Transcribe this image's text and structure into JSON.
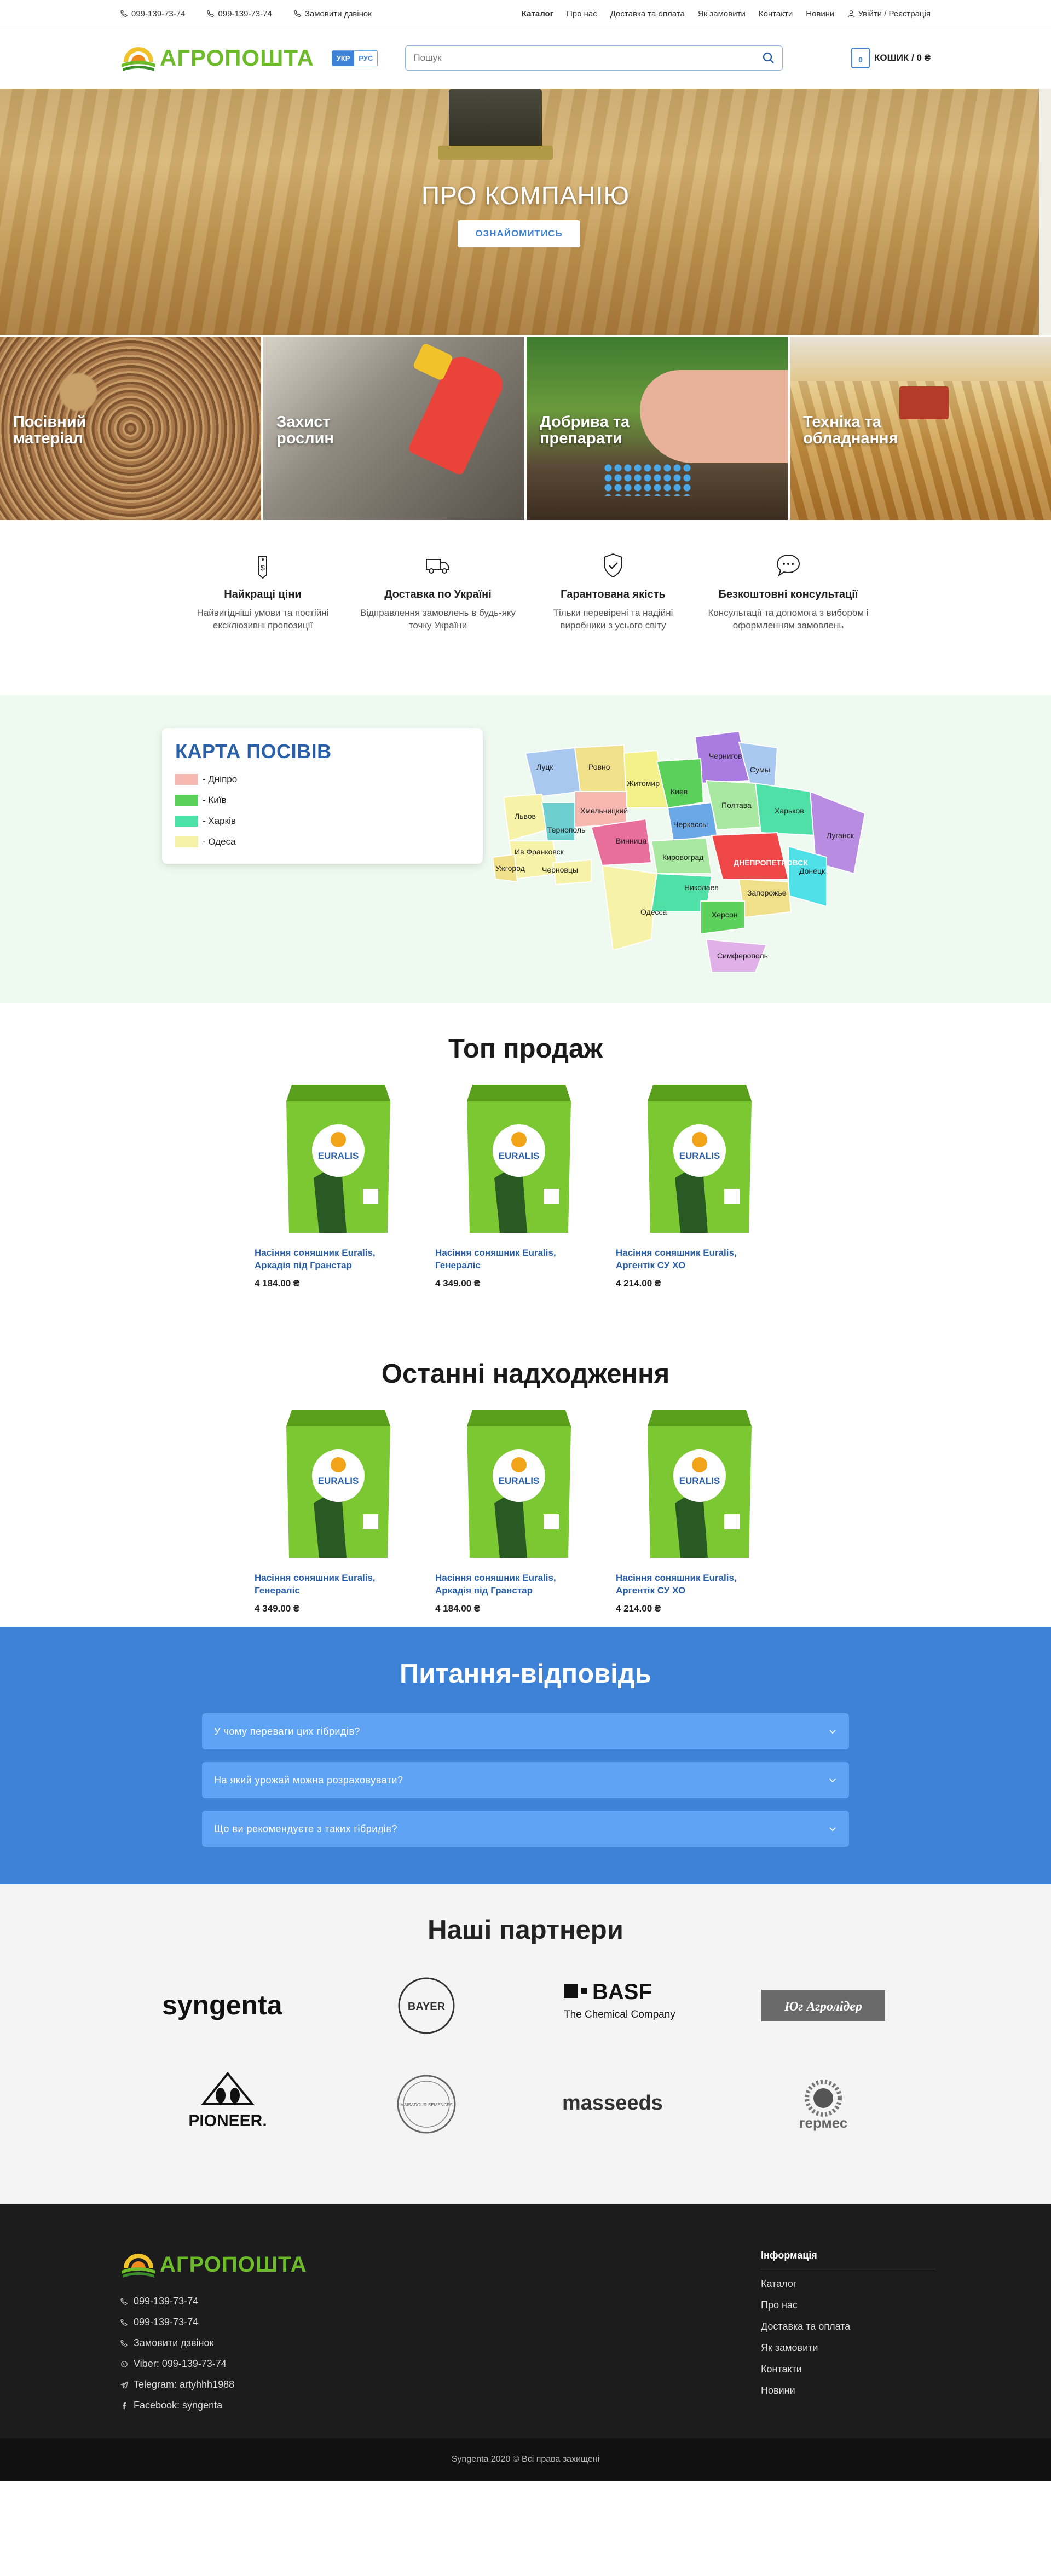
{
  "topbar": {
    "phone1": "099-139-73-74",
    "phone2": "099-139-73-74",
    "callback": "Замовити дзвінок",
    "nav": [
      "Каталог",
      "Про нас",
      "Доставка та оплата",
      "Як замовити",
      "Контакти",
      "Новини"
    ],
    "auth": "Увійти / Реєстрація"
  },
  "header": {
    "logo": "АГРОПОШТА",
    "lang_active": "УКР",
    "lang_other": "РУС",
    "search_placeholder": "Пошук",
    "cart_count": "0",
    "cart_label": "КОШИК / 0 ₴"
  },
  "hero": {
    "title": "ПРО КОМПАНІЮ",
    "button": "ОЗНАЙОМИТИСЬ"
  },
  "categories": [
    "Посівний матеріал",
    "Захист рослин",
    "Добрива та препарати",
    "Техніка та обладнання"
  ],
  "features": [
    {
      "icon": "price-tag-icon",
      "title": "Найкращі ціни",
      "text": "Найвигідніші умови та постійні ексклюзивні пропозиції"
    },
    {
      "icon": "truck-icon",
      "title": "Доставка по Україні",
      "text": "Відправлення замовлень в будь-яку точку України"
    },
    {
      "icon": "shield-check-icon",
      "title": "Гарантована якість",
      "text": "Тільки перевірені та надійні виробники з усього світу"
    },
    {
      "icon": "chat-icon",
      "title": "Безкоштовні консультації",
      "text": "Консультації та допомога з вибором і оформленням замовлень"
    }
  ],
  "map": {
    "title": "КАРТА ПОСІВІВ",
    "legend": [
      {
        "label": "- Дніпро",
        "color": "#f6b7b0"
      },
      {
        "label": "- Київ",
        "color": "#5bd05b"
      },
      {
        "label": "- Харків",
        "color": "#4fe0a8"
      },
      {
        "label": "- Одеса",
        "color": "#f6f3a8"
      }
    ],
    "regions": [
      "Луцк",
      "Ровно",
      "Житомир",
      "Чернигов",
      "Сумы",
      "Львов",
      "Киев",
      "Полтава",
      "Харьков",
      "Хмельницкий",
      "Тернополь",
      "Черкассы",
      "Винница",
      "Ив.Франковск",
      "Ужгород",
      "Черновцы",
      "Кировоград",
      "ДНЕПРОПЕТРОВСК",
      "Луганск",
      "Донецк",
      "Запорожье",
      "Одесса",
      "Николаев",
      "Херсон",
      "Симферополь"
    ]
  },
  "top_sales": {
    "title": "Топ продаж",
    "items": [
      {
        "name": "Насіння соняшник Euralis, Аркадія під Гранстар",
        "price": "4 184.00 ₴"
      },
      {
        "name": "Насіння соняшник Euralis, Генераліс",
        "price": "4 349.00 ₴"
      },
      {
        "name": "Насіння соняшник Euralis, Аргентік СУ ХО",
        "price": "4 214.00 ₴"
      }
    ]
  },
  "latest": {
    "title": "Останні надходження",
    "items": [
      {
        "name": "Насіння соняшник Euralis, Генераліс",
        "price": "4 349.00 ₴"
      },
      {
        "name": "Насіння соняшник Euralis, Аркадія під Гранстар",
        "price": "4 184.00 ₴"
      },
      {
        "name": "Насіння соняшник Euralis, Аргентік СУ ХО",
        "price": "4 214.00 ₴"
      }
    ]
  },
  "product_brand": "EURALIS",
  "faq": {
    "title": "Питання-відповідь",
    "items": [
      "У чому переваги цих гібридів?",
      "На який урожай можна розраховувати?",
      "Що ви рекомендуєте з таких гібридів?"
    ]
  },
  "partners": {
    "title": "Наші партнери",
    "logos": [
      "syngenta",
      "BAYER",
      "BASF",
      "The Chemical Company",
      "Юг Агролідер",
      "PIONEER.",
      "MAISADOUR SEMENCES",
      "masseeds",
      "гермес"
    ]
  },
  "footer": {
    "logo": "АГРОПОШТА",
    "contacts": [
      "099-139-73-74",
      "099-139-73-74",
      "Замовити дзвінок",
      "Viber: 099-139-73-74",
      "Telegram: artyhhh1988",
      "Facebook: syngenta"
    ],
    "info_title": "Інформація",
    "links": [
      "Каталог",
      "Про нас",
      "Доставка та оплата",
      "Як замовити",
      "Контакти",
      "Новини"
    ],
    "copyright": "Syngenta 2020 © Всі права захищені"
  }
}
